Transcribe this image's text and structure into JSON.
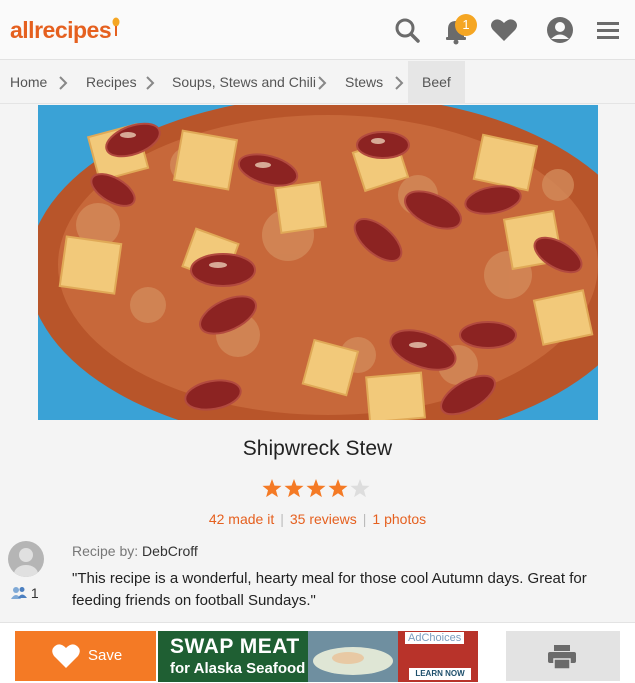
{
  "header": {
    "logo": "allrecipes",
    "notification_count": "1"
  },
  "breadcrumb": [
    "Home",
    "Recipes",
    "Soups, Stews and Chili",
    "Stews",
    "Beef"
  ],
  "recipe": {
    "title": "Shipwreck Stew",
    "rating": 4,
    "rating_max": 5,
    "made_it": "42 made it",
    "reviews": "35 reviews",
    "photos": "1 photos",
    "byline_label": "Recipe by:",
    "author": "DebCroff",
    "followers": "1",
    "description": "\"This recipe is a wonderful, hearty meal for those cool Autumn days. Great for feeding friends on football Sundays.\""
  },
  "actions": {
    "save_label": "Save"
  },
  "ad": {
    "headline": "SWAP MEAT",
    "subline": "for Alaska Seafood",
    "choices": "AdChoices",
    "cta": "LEARN NOW"
  },
  "colors": {
    "brand_orange": "#e5601f",
    "save_orange": "#f47a25",
    "star_filled": "#f47a25",
    "star_empty": "#dddddd"
  },
  "icons": [
    "search-icon",
    "bell-icon",
    "heart-icon",
    "profile-icon",
    "menu-icon",
    "chevron-right-icon",
    "star-icon",
    "followers-icon",
    "print-icon"
  ]
}
